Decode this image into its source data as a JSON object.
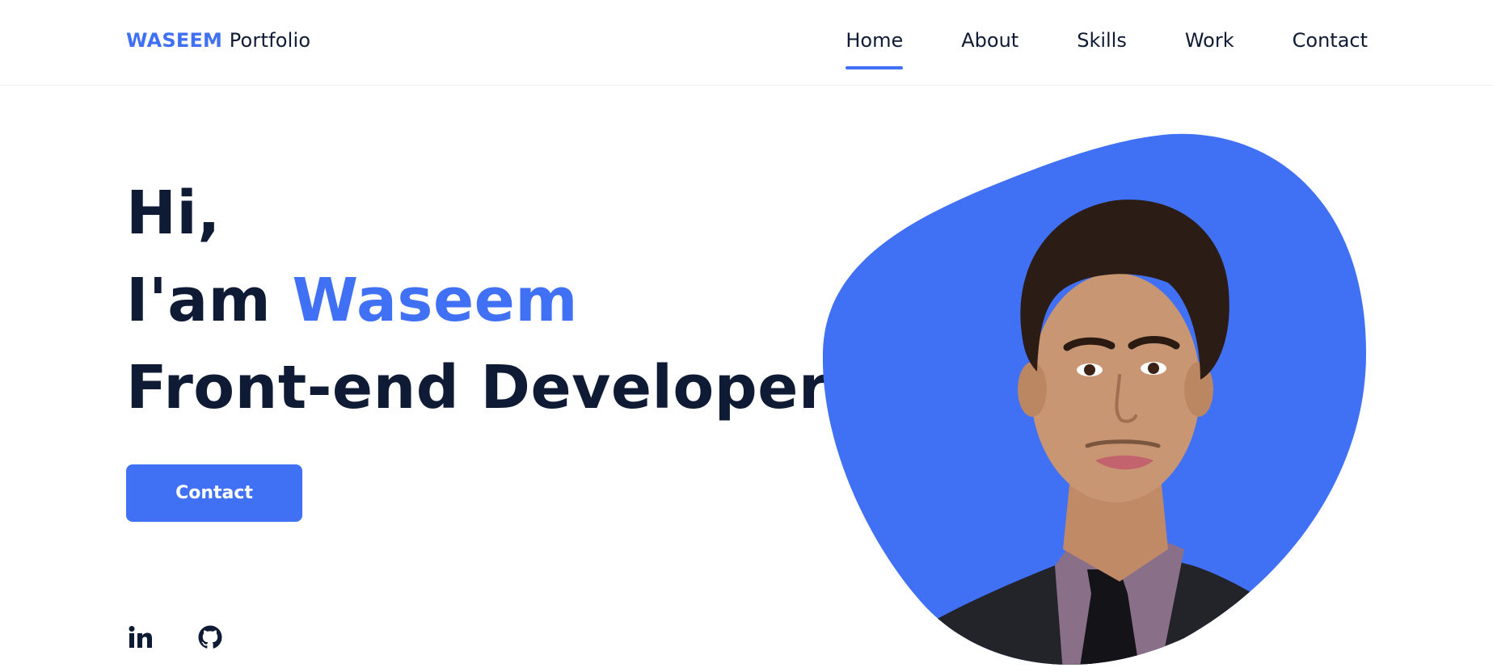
{
  "header": {
    "logo_accent": "WASEEM",
    "logo_rest": "Portfolio",
    "nav": [
      {
        "label": "Home",
        "active": true
      },
      {
        "label": "About",
        "active": false
      },
      {
        "label": "Skills",
        "active": false
      },
      {
        "label": "Work",
        "active": false
      },
      {
        "label": "Contact",
        "active": false
      }
    ]
  },
  "hero": {
    "greeting": "Hi,",
    "intro_prefix": "I'am ",
    "name": "Waseem",
    "role": "Front-end Developer",
    "cta_label": "Contact"
  },
  "socials": [
    {
      "icon": "linkedin-icon"
    },
    {
      "icon": "github-icon"
    }
  ],
  "colors": {
    "accent": "#4070f4",
    "text": "#0f1b34",
    "background": "#ffffff"
  }
}
